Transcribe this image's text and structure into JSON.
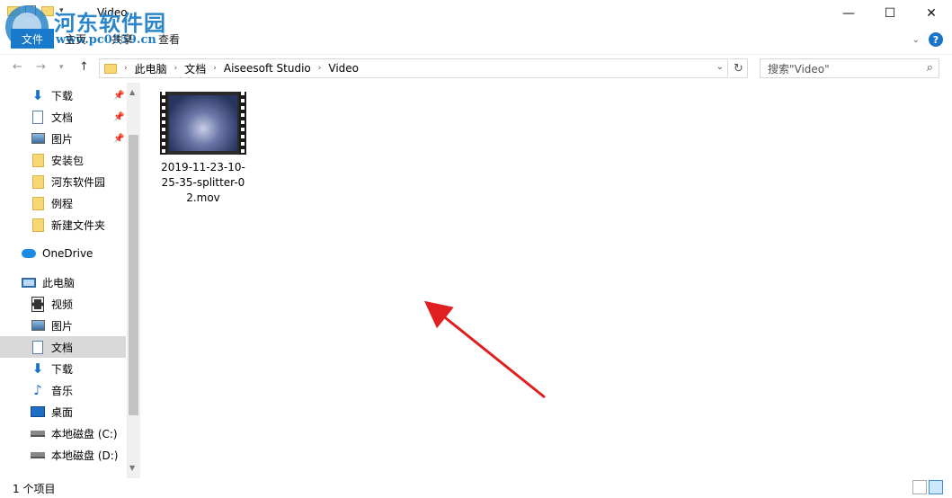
{
  "window": {
    "title": "Video",
    "controls": {
      "minimize": "—",
      "maximize": "☐",
      "close": "✕"
    }
  },
  "watermark": {
    "text": "河东软件园",
    "url": "www.pc0359.cn"
  },
  "ribbon": {
    "tabs": [
      "文件",
      "主页",
      "共享",
      "查看"
    ],
    "help": "?"
  },
  "navigation": {
    "breadcrumb": [
      "此电脑",
      "文档",
      "Aiseesoft Studio",
      "Video"
    ],
    "search_placeholder": "搜索\"Video\""
  },
  "sidebar": {
    "items": [
      {
        "label": "下载",
        "icon": "download-icon",
        "pinned": true
      },
      {
        "label": "文档",
        "icon": "document-icon",
        "pinned": true
      },
      {
        "label": "图片",
        "icon": "picture-icon",
        "pinned": true
      },
      {
        "label": "安装包",
        "icon": "folder-icon",
        "pinned": false
      },
      {
        "label": "河东软件园",
        "icon": "folder-icon",
        "pinned": false
      },
      {
        "label": "例程",
        "icon": "folder-icon",
        "pinned": false
      },
      {
        "label": "新建文件夹",
        "icon": "folder-icon",
        "pinned": false
      },
      {
        "label": "OneDrive",
        "icon": "cloud-icon",
        "pinned": false
      },
      {
        "label": "此电脑",
        "icon": "computer-icon",
        "pinned": false
      },
      {
        "label": "视频",
        "icon": "video-icon",
        "pinned": false
      },
      {
        "label": "图片",
        "icon": "picture-icon",
        "pinned": false
      },
      {
        "label": "文档",
        "icon": "document-icon",
        "pinned": false,
        "selected": true
      },
      {
        "label": "下载",
        "icon": "download-icon",
        "pinned": false
      },
      {
        "label": "音乐",
        "icon": "music-icon",
        "pinned": false
      },
      {
        "label": "桌面",
        "icon": "desktop-icon",
        "pinned": false
      },
      {
        "label": "本地磁盘 (C:)",
        "icon": "drive-icon",
        "pinned": false
      },
      {
        "label": "本地磁盘 (D:)",
        "icon": "drive-icon",
        "pinned": false
      }
    ]
  },
  "files": [
    {
      "name": "2019-11-23-10-25-35-splitter-02.mov",
      "type": "video"
    }
  ],
  "status": {
    "item_count": "1 个项目"
  },
  "colors": {
    "accent": "#1979ca",
    "selection": "#d9d9d9",
    "arrow": "#e02020"
  }
}
